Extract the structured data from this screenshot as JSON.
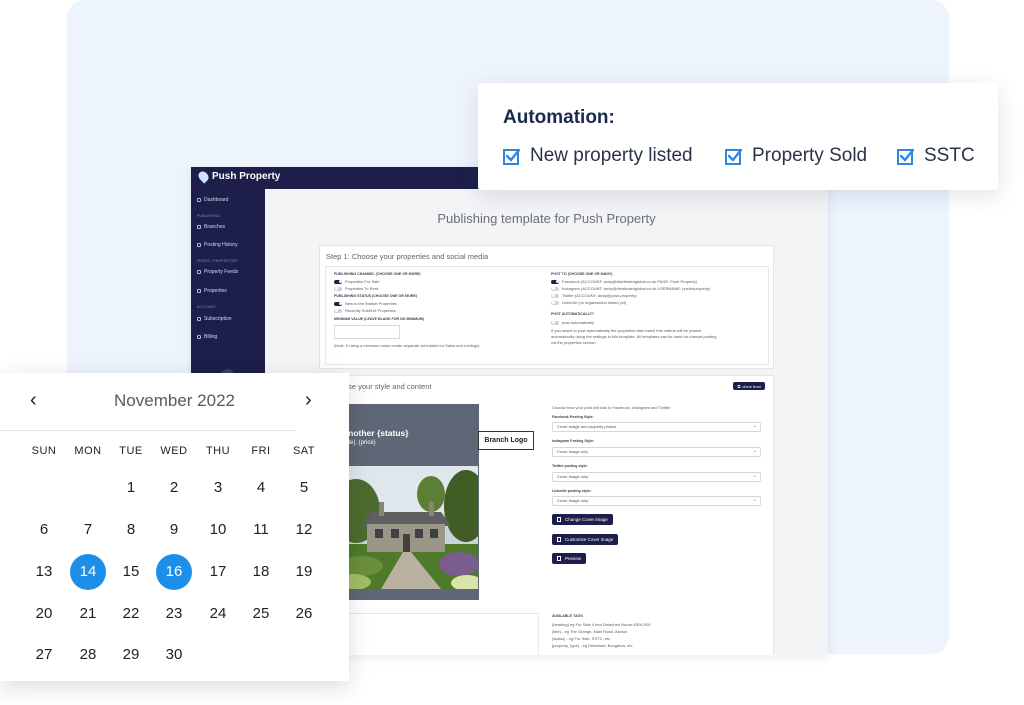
{
  "app": {
    "brand": "Push Property",
    "sidebar": {
      "dashboard": "Dashboard",
      "section_publishing": "PUBLISHING",
      "branches": "Branches",
      "posting_history": "Posting History",
      "section_feeds": "FEEDS / PROPERTIES",
      "property_feeds": "Property Feeds",
      "properties": "Properties",
      "section_account": "ACCOUNT",
      "subscription": "Subscription",
      "billing": "Billing",
      "collapse": "‹"
    },
    "page_title": "Publishing template for Push Property",
    "step1": {
      "title": "Step 1: Choose your properties and social media",
      "channel_heading": "PUBLISHING CHANNEL (CHOOSE ONE OR MORE)",
      "channel_sale": "Properties For Sale",
      "channel_rent": "Properties To Rent",
      "status_heading": "PUBLISHING STATUS (CHOOSE ONE OR MORE)",
      "status_new": "New to the Market Properties",
      "status_sold": "Recently Sold/Let Properties",
      "min_heading": "MINIMUM VALUE (LEAVE BLANK FOR NO MINIMUM)",
      "min_note": "(Note: If using a minimum value create separate schedules for Sales and Lettings)",
      "post_to_heading": "POST TO (CHOOSE ONE OR MANY)",
      "facebook": "Facebook (ACCOUNT: andy@distributedglobal.co.uk PAGE: Push Property)",
      "instagram": "Instagram (ACCOUNT: andy@distributedglobal.co.uk USERNAME: pushtoproperty)",
      "twitter": "Twitter (ACCOUNT: andy@push-property)",
      "linkedin": "LinkedIn (no organisation linked yet)",
      "auto_heading": "POST AUTOMATICALLY?",
      "auto_label": "post automatically",
      "auto_note1": "If you select to post automatically the properties that match this criteria will be posted",
      "auto_note2": "automatically using the settings in this template. All templates can be used for manual posting",
      "auto_note3": "via the properties section."
    },
    "step2": {
      "title": ": Choose your style and content",
      "clone": "clone from",
      "preview_line1": "Another {status}",
      "preview_line2": "{title}, {price}",
      "branch_logo": "Branch Logo",
      "intro": "Choose how your post will look in Facebook, Instagram and Twitter",
      "fb_label": "Facebook Posting Style:",
      "fb_value": "Cover image and property photos",
      "ig_label": "Instagram Posting Style:",
      "ig_value": "Cover image only",
      "tw_label": "Twitter posting style:",
      "tw_value": "Cover image only",
      "li_label": "LinkedIn posting style:",
      "li_value": "Cover image only",
      "btn_change": "Change Cover Image",
      "btn_customise": "Customise Cover Image",
      "btn_preview": "Preview",
      "tags_heading": "AVAILABLE TAGS",
      "tag1": "{heading} eg For Sale 4 bed Detached House £500,000",
      "tag2": "{title} - eg The Grange, Main Road, Ashton",
      "tag3": "{status} - eg For Sale, SSTC, etc",
      "tag4": "{property_type} - eg Detached, Bungalow, etc",
      "textarea_fragment": "ng}"
    }
  },
  "automation": {
    "title": "Automation:",
    "items": [
      "New property listed",
      "Property Sold",
      "SSTC"
    ],
    "check_color": "#2f86e0"
  },
  "calendar": {
    "month": "November 2022",
    "prev": "‹",
    "next": "›",
    "weekdays": [
      "SUN",
      "MON",
      "TUE",
      "WED",
      "THU",
      "FRI",
      "SAT"
    ],
    "selected_days": [
      14,
      16
    ],
    "accent": "#1d8fe8"
  }
}
